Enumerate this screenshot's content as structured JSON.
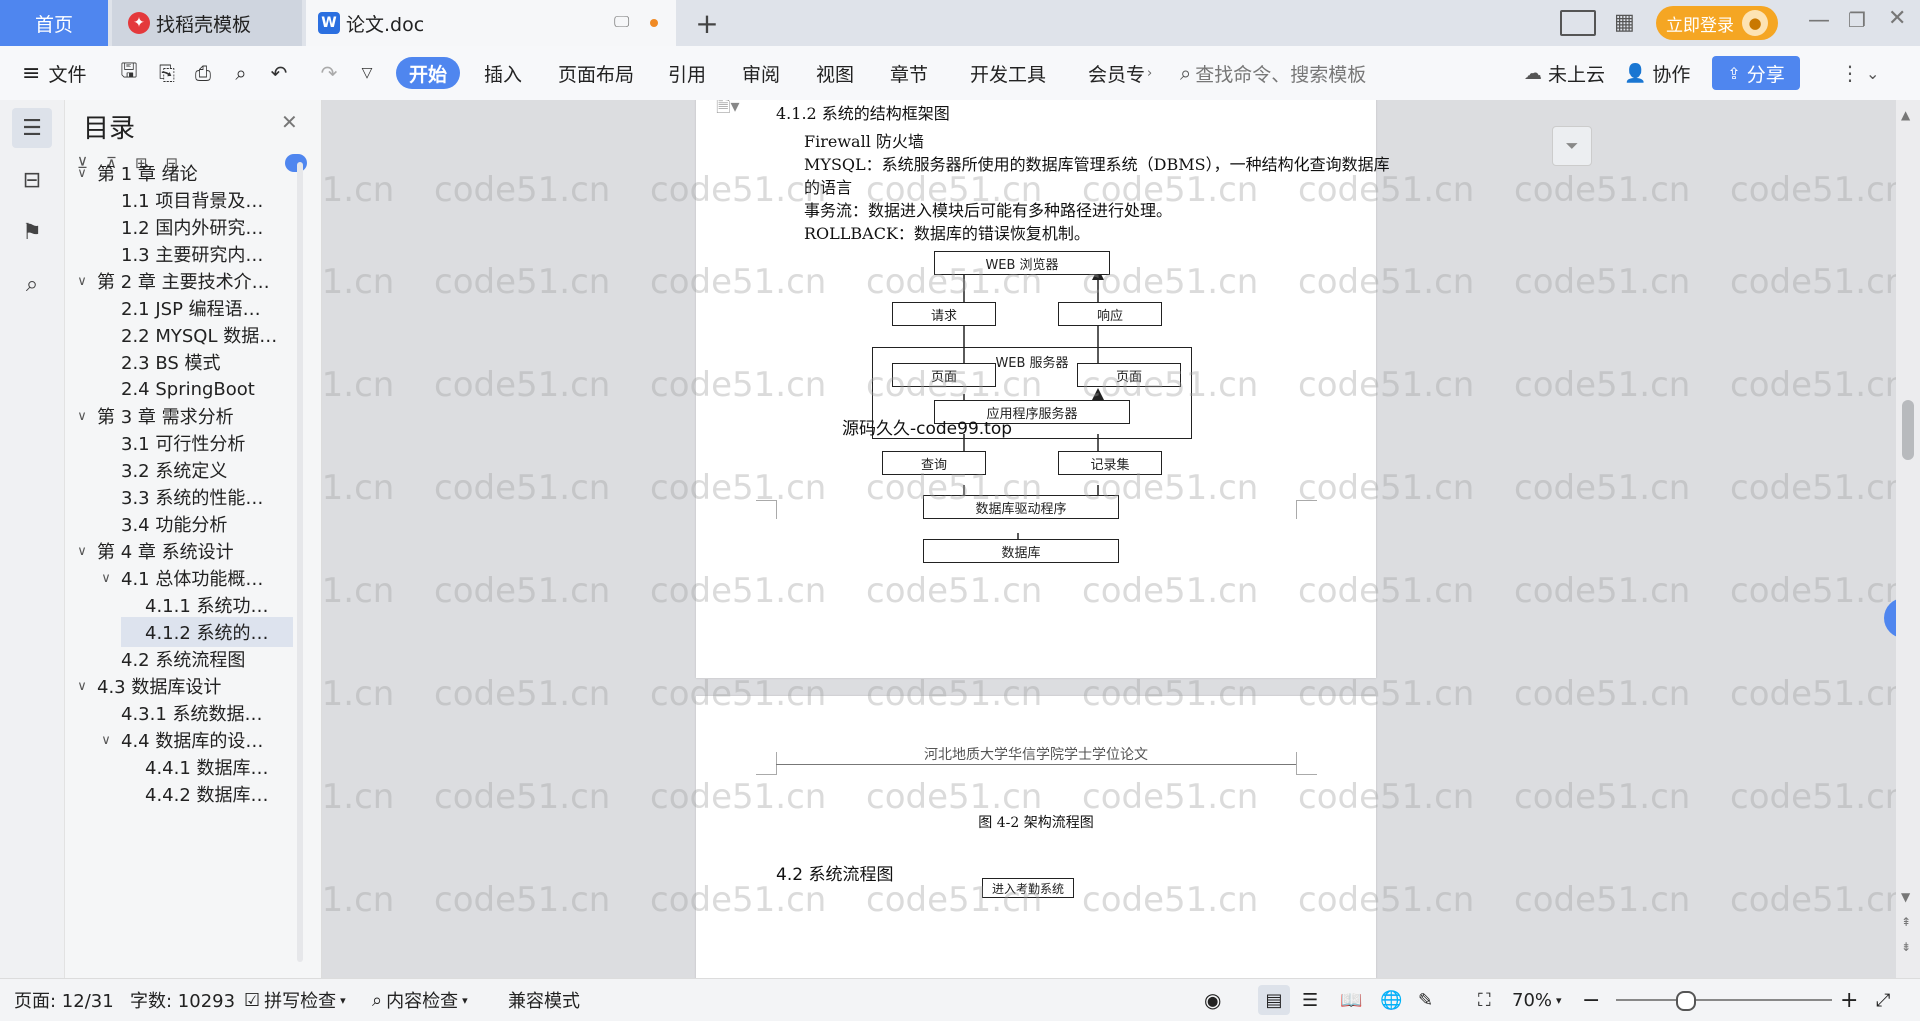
{
  "tabs": {
    "home": "首页",
    "templates": "找稻壳模板",
    "document": "论文.doc"
  },
  "window": {
    "login_button": "立即登录"
  },
  "toolbar": {
    "file_menu": "文件",
    "ribbon_tabs": [
      "开始",
      "插入",
      "页面布局",
      "引用",
      "审阅",
      "视图",
      "章节",
      "开发工具",
      "会员专"
    ],
    "search_placeholder": "查找命令、搜索模板",
    "cloud_status": "未上云",
    "collaborate": "协作",
    "share": "分享"
  },
  "toc": {
    "title": "目录",
    "items": [
      {
        "level": 1,
        "text": "第 1 章  绪论",
        "expanded": true
      },
      {
        "level": 2,
        "text": "1.1  项目背景及…"
      },
      {
        "level": 2,
        "text": "1.2  国内外研究…"
      },
      {
        "level": 2,
        "text": "1.3  主要研究内…"
      },
      {
        "level": 1,
        "text": "第 2 章  主要技术介…",
        "expanded": true
      },
      {
        "level": 2,
        "text": "2.1 JSP  编程语…"
      },
      {
        "level": 2,
        "text": "2.2 MYSQL 数据…"
      },
      {
        "level": 2,
        "text": "2.3 BS 模式"
      },
      {
        "level": 2,
        "text": "2.4 SpringBoot"
      },
      {
        "level": 1,
        "text": "第 3 章  需求分析",
        "expanded": true
      },
      {
        "level": 2,
        "text": "3.1  可行性分析"
      },
      {
        "level": 2,
        "text": "3.2  系统定义"
      },
      {
        "level": 2,
        "text": "3.3  系统的性能…"
      },
      {
        "level": 2,
        "text": "3.4  功能分析"
      },
      {
        "level": 1,
        "text": "第 4 章  系统设计",
        "expanded": true
      },
      {
        "level": 2,
        "text": "4.1  总体功能概…",
        "expanded": true
      },
      {
        "level": 3,
        "text": "4.1.1 系统功…"
      },
      {
        "level": 3,
        "text": "4.1.2  系统的…",
        "selected": true
      },
      {
        "level": 2,
        "text": "4.2  系统流程图"
      },
      {
        "level": 1,
        "text": "4.3 数据库设计",
        "expanded": true
      },
      {
        "level": 2,
        "text": "4.3.1  系统数据…"
      },
      {
        "level": 2,
        "text": "4.4  数据库的设…",
        "expanded": true
      },
      {
        "level": 3,
        "text": "4.4.1  数据库…"
      },
      {
        "level": 3,
        "text": "4.4.2  数据库…"
      }
    ]
  },
  "document": {
    "page1": {
      "heading": "4.1.2  系统的结构框架图",
      "paragraphs": [
        "Firewall  防火墙",
        "MYSQL：系统服务器所使用的数据库管理系统（DBMS），一种结构化查询数据库",
        "的语言",
        "事务流：数据进入模块后可能有多种路径进行处理。",
        "ROLLBACK：数据库的错误恢复机制。"
      ]
    },
    "diagram": {
      "browser": "WEB 浏览器",
      "request": "请求",
      "response": "响应",
      "web_server": "WEB 服务器",
      "page_left": "页面",
      "page_right": "页面",
      "app_server": "应用程序服务器",
      "query": "查询",
      "recordset": "记录集",
      "db_driver": "数据库驱动程序",
      "database": "数据库",
      "overlay_text": "源码久久-code99.top"
    },
    "page2": {
      "header": "河北地质大学华信学院学士学位论文",
      "caption": "图 4-2 架构流程图",
      "heading": "4.2  系统流程图",
      "flow_box": "进入考勤系统"
    },
    "watermark": "code51.cn"
  },
  "status": {
    "page": "页面: 12/31",
    "words": "字数: 10293",
    "spell_check": "拼写检查",
    "content_check": "内容检查",
    "compat_mode": "兼容模式",
    "zoom": "70%"
  },
  "colors": {
    "accent_blue": "#4f86ef",
    "login_orange": "#f5a623",
    "selected_toc": "#dde3ee",
    "doc_badge_blue": "#2b6fe0",
    "templates_badge_red": "#e4393c"
  }
}
